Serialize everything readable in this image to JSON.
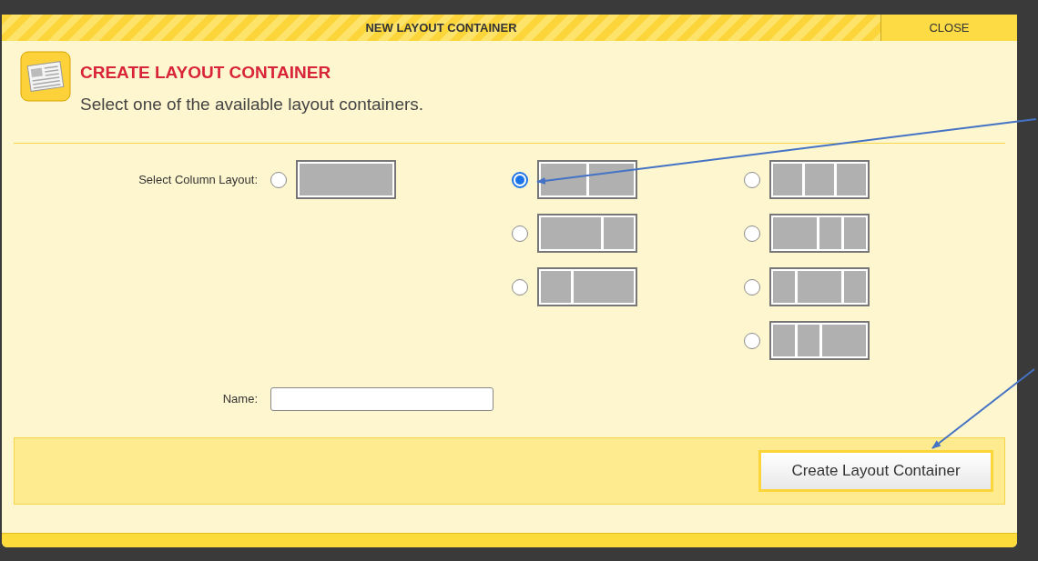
{
  "window": {
    "title": "NEW LAYOUT CONTAINER",
    "close": "CLOSE"
  },
  "header": {
    "title": "CREATE LAYOUT CONTAINER",
    "subtitle": "Select one of the available layout containers."
  },
  "layout_field": {
    "label": "Select Column Layout:",
    "option_groups": [
      [
        {
          "kind": "single",
          "selected": false
        }
      ],
      [
        {
          "kind": "halves",
          "selected": true
        },
        {
          "kind": "leftwide",
          "selected": false
        },
        {
          "kind": "rightwide",
          "selected": false
        }
      ],
      [
        {
          "kind": "thirds",
          "selected": false
        },
        {
          "kind": "leftwide3",
          "selected": false
        },
        {
          "kind": "middlewide",
          "selected": false
        },
        {
          "kind": "rightwide3",
          "selected": false
        }
      ]
    ]
  },
  "name_field": {
    "label": "Name:"
  },
  "submit_button": "Create Layout Container"
}
